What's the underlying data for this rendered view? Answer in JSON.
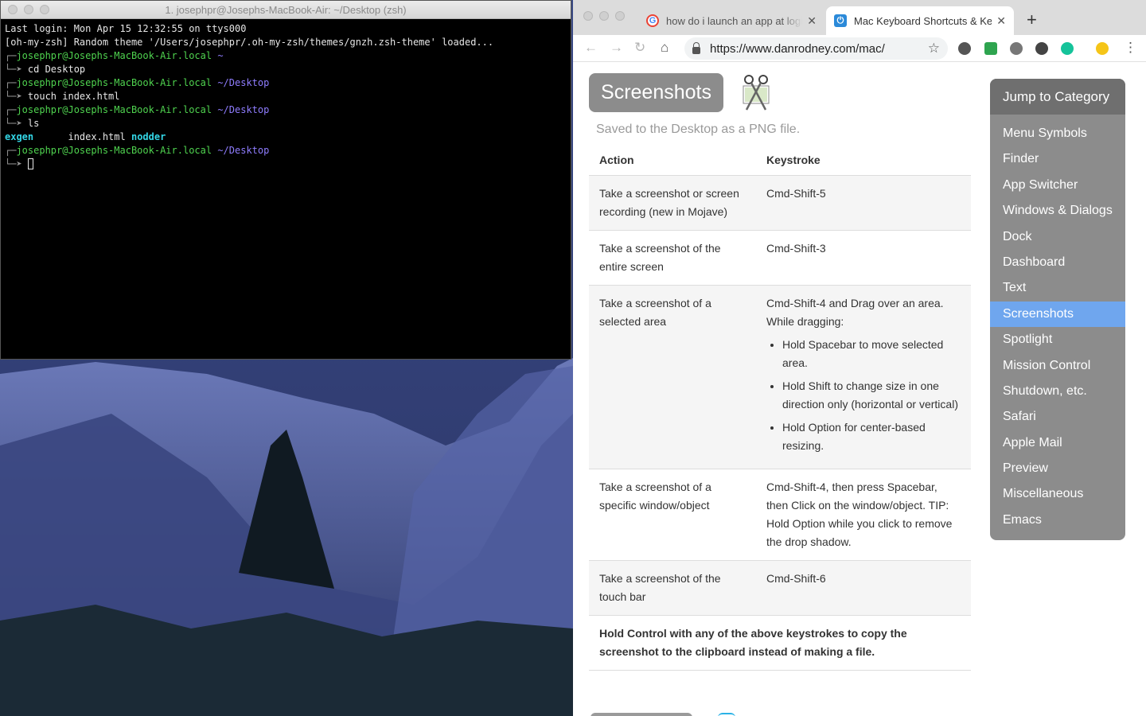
{
  "terminal": {
    "title": "1. josephpr@Josephs-MacBook-Air: ~/Desktop (zsh)",
    "lines": {
      "login": "Last login: Mon Apr 15 12:32:55 on ttys000",
      "theme": "[oh-my-zsh] Random theme '/Users/josephpr/.oh-my-zsh/themes/gnzh.zsh-theme' loaded...",
      "user": "josephpr",
      "host": "@Josephs-MacBook-Air.local",
      "dir_home": "~",
      "dir_desktop": "~/Desktop",
      "cmd1": "cd Desktop",
      "cmd2": "touch index.html",
      "cmd3": "ls",
      "ls_item1": "exgen",
      "ls_item2": "index.html",
      "ls_item3": "nodder"
    }
  },
  "browser": {
    "tabs": [
      {
        "label": "how do i launch an app at login",
        "favicon": "G"
      },
      {
        "label": "Mac Keyboard Shortcuts & Keystrokes",
        "favicon": "⏻"
      }
    ],
    "url": "https://www.danrodney.com/mac/",
    "page": {
      "section_title": "Screenshots",
      "subtitle": "Saved to the Desktop as a PNG file.",
      "table": {
        "header_action": "Action",
        "header_keystroke": "Keystroke",
        "rows": [
          {
            "action": "Take a screenshot or screen recording (new in Mojave)",
            "keystroke": "Cmd-Shift-5"
          },
          {
            "action": "Take a screenshot of the entire screen",
            "keystroke": "Cmd-Shift-3"
          },
          {
            "action": "Take a screenshot of a selected area",
            "keystroke": "Cmd-Shift-4 and Drag over an area. While dragging:",
            "bullets": [
              "Hold Spacebar to move selected area.",
              "Hold Shift to change size in one direction only (horizontal or vertical)",
              "Hold Option for center-based resizing."
            ]
          },
          {
            "action": "Take a screenshot of a specific window/object",
            "keystroke": "Cmd-Shift-4, then press Spacebar, then Click on the window/object. TIP: Hold Option while you click to remove the drop shadow."
          },
          {
            "action": "Take a screenshot of the touch bar",
            "keystroke": "Cmd-Shift-6"
          }
        ],
        "note": "Hold Control with any of the above keystrokes to copy the screenshot to the clipboard instead of making a file."
      },
      "sidebar": {
        "heading": "Jump to Category",
        "items": [
          "Menu Symbols",
          "Finder",
          "App Switcher",
          "Windows & Dialogs",
          "Dock",
          "Dashboard",
          "Text",
          "Screenshots",
          "Spotlight",
          "Mission Control",
          "Shutdown, etc.",
          "Safari",
          "Apple Mail",
          "Preview",
          "Miscellaneous",
          "Emacs"
        ],
        "active": "Screenshots"
      }
    }
  },
  "colors": {
    "sidebar_active": "#6fa6ee",
    "terminal_green": "#4fd34f",
    "terminal_purple": "#8f7dff",
    "terminal_cyan": "#33d6e6"
  }
}
